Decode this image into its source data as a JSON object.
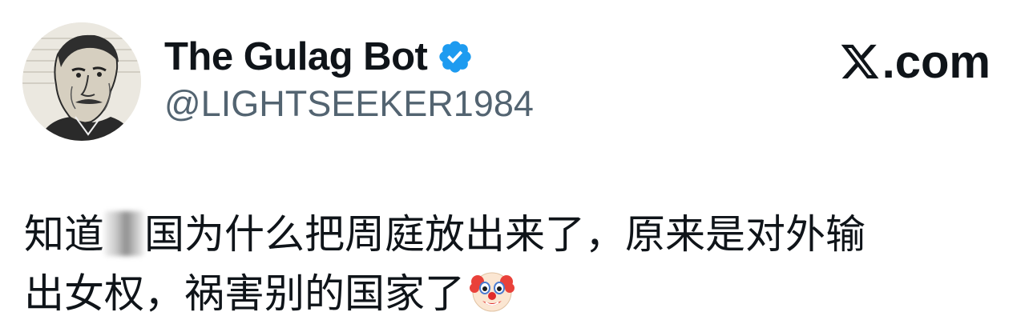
{
  "profile": {
    "display_name": "The Gulag Bot",
    "handle": "@LIGHTSEEKER1984",
    "verified_icon": "verified-badge-icon",
    "avatar": "portrait-sketch"
  },
  "brand": {
    "label": ".com",
    "logo_icon": "x-logo-icon"
  },
  "tweet": {
    "line1_part1": "知道",
    "line1_part2": "国为什么把周庭放出来了，原来是对外输",
    "line2": "出女权，祸害别的国家了",
    "redaction": "blurred-character",
    "emoji": "clown-face-icon"
  },
  "colors": {
    "text_primary": "#0f1419",
    "text_secondary": "#536471",
    "verified_blue": "#1d9bf0",
    "background": "#ffffff"
  }
}
